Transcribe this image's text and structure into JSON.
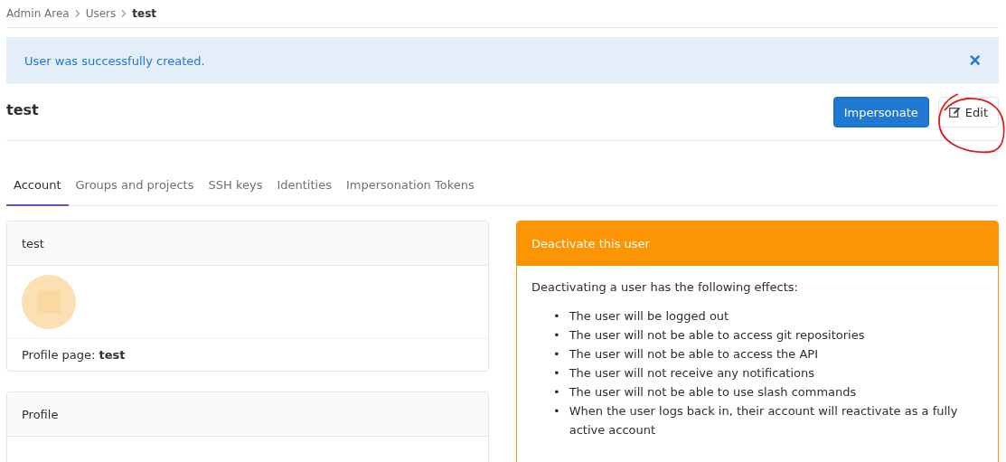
{
  "breadcrumb": [
    {
      "label": "Admin Area",
      "current": false
    },
    {
      "label": "Users",
      "current": false
    },
    {
      "label": "test",
      "current": true
    }
  ],
  "alert": {
    "message": "User was successfully created.",
    "close": "×"
  },
  "page_title": "test",
  "buttons": [
    {
      "label": "Impersonate",
      "kind": "primary"
    },
    {
      "label": "Edit",
      "kind": "edit"
    }
  ],
  "tabs": [
    {
      "label": "Account",
      "selected": true
    },
    {
      "label": "Groups and projects",
      "selected": false
    },
    {
      "label": "SSH keys",
      "selected": false
    },
    {
      "label": "Identities",
      "selected": false
    },
    {
      "label": "Impersonation Tokens",
      "selected": false
    }
  ],
  "account_card": {
    "title": "test",
    "profile_label": "Profile page:",
    "profile_value": "test"
  },
  "profile_card": {
    "title": "Profile"
  },
  "deactivate_card": {
    "title": "Deactivate this user",
    "intro": "Deactivating a user has the following effects:",
    "bullet": "•",
    "effects": [
      "The user will be logged out",
      "The user will not be able to access git repositories",
      "The user will not be able to access the API",
      "The user will not receive any notifications",
      "The user will not be able to use slash commands",
      "When the user logs back in, their account will reactivate as a fully active account"
    ]
  }
}
